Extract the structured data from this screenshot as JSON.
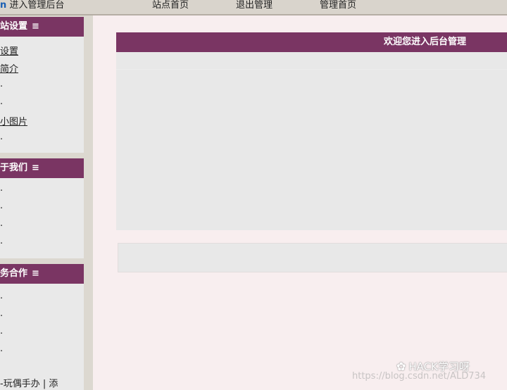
{
  "topbar": {
    "brand_letter": "n",
    "brand_text": " 进入管理后台",
    "links": [
      "站点首页",
      "退出管理",
      "管理首页"
    ]
  },
  "sidebar": {
    "panels": [
      {
        "title": "站设置",
        "items": [
          "设置",
          "简介",
          "·",
          "·",
          "小图片",
          "·"
        ]
      },
      {
        "title": "于我们",
        "items": [
          "·",
          "·",
          "·",
          "·"
        ]
      },
      {
        "title": "务合作",
        "items": [
          "·",
          "·",
          "·",
          "·",
          "-玩偶手办 | 添"
        ]
      }
    ]
  },
  "main": {
    "welcome_title": "欢迎您进入后台管理"
  },
  "watermark": {
    "url": "https://blog.csdn.net/ALD734",
    "account": "HACK学习呀"
  },
  "colors": {
    "accent": "#7a3563",
    "background": "#f8eeef",
    "panel": "#e8e8e8"
  }
}
